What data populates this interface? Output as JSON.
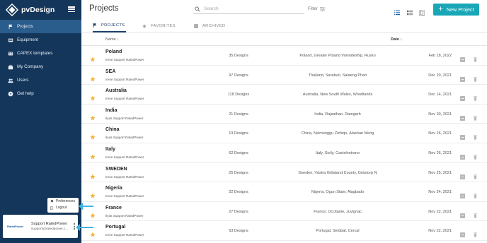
{
  "app": {
    "brand": "pvDesign"
  },
  "sidebar": {
    "items": [
      {
        "label": "Projects",
        "icon": "flag-icon",
        "active": true
      },
      {
        "label": "Equipment",
        "icon": "equipment-icon",
        "active": false
      },
      {
        "label": "CAPEX templates",
        "icon": "capex-icon",
        "active": false
      },
      {
        "label": "My Company",
        "icon": "briefcase-icon",
        "active": false
      },
      {
        "label": "Users",
        "icon": "users-icon",
        "active": false
      },
      {
        "label": "Get help",
        "icon": "help-icon",
        "active": false
      }
    ],
    "user": {
      "name": "Support RatedPower",
      "email": "support@ratedpower.c...",
      "company_logo_text": "RatedPower"
    },
    "popup": {
      "preferences": "Preferences",
      "logout": "Logout"
    }
  },
  "header": {
    "title": "Projects",
    "search_placeholder": "Search",
    "filter_label": "Filter",
    "new_project_label": "New Project"
  },
  "tabs": [
    {
      "label": "PROJECTS",
      "icon": "flag-icon",
      "active": true
    },
    {
      "label": "FAVORITES",
      "icon": "star-icon",
      "active": false
    },
    {
      "label": "ARCHIVED",
      "icon": "archive-icon",
      "active": false
    }
  ],
  "columns": {
    "name": "Name ↓",
    "date": "Date ↓"
  },
  "projects": [
    {
      "name": "Poland",
      "owner": "Irene Support RatedPower",
      "designs": "35 Designs",
      "location": "Poland, Greater Poland Voivodeship, Rusko",
      "date": "Feb 18, 2022"
    },
    {
      "name": "SEA",
      "owner": "Irene Support RatedPower",
      "designs": "97 Designs",
      "location": "Thailand, Saraburi, Salaeng Phan",
      "date": "Dec 20, 2021"
    },
    {
      "name": "Australia",
      "owner": "Irene Support RatedPower",
      "designs": "118 Designs",
      "location": "Australia, New South Wales, Woodlands",
      "date": "Dec 14, 2021"
    },
    {
      "name": "India",
      "owner": "Ilyas Support RatedPower",
      "designs": "21 Designs",
      "location": "India, Rajasthan, Ramgarh",
      "date": "Nov 30, 2021"
    },
    {
      "name": "China",
      "owner": "Ilyas Support RatedPower",
      "designs": "19 Designs",
      "location": "China, Neimenggu Zizhiqu, Alashan Meng",
      "date": "Nov 26, 2021"
    },
    {
      "name": "Italy",
      "owner": "Irene Support RatedPower",
      "designs": "62 Designs",
      "location": "Italy, Sicily, Castelvetrano",
      "date": "Nov 26, 2021"
    },
    {
      "name": "SWEDEN",
      "owner": "Irene Support RatedPower",
      "designs": "25 Designs",
      "location": "Sweden, Västra Götaland County, Grästorp N",
      "date": "Nov 25, 2021"
    },
    {
      "name": "Nigeria",
      "owner": "Irene Support RatedPower",
      "designs": "22 Designs",
      "location": "Nigeria, Ogun State, Alagbado",
      "date": "Nov 24, 2021"
    },
    {
      "name": "France",
      "owner": "Ilyas Support RatedPower",
      "designs": "27 Designs",
      "location": "France, Occitanie, Juvignac",
      "date": "Nov 22, 2021"
    },
    {
      "name": "Portugal",
      "owner": "Irene Support RatedPower",
      "designs": "63 Designs",
      "location": "Portugal, Setúbal, Cercal",
      "date": "Nov 22, 2021"
    }
  ],
  "colors": {
    "sidebar": "#14365a",
    "sidebar_active": "#2a5c8c",
    "accent": "#18a7b6",
    "star": "#f3b63a",
    "annotation_arrow": "#3cb4e0"
  }
}
